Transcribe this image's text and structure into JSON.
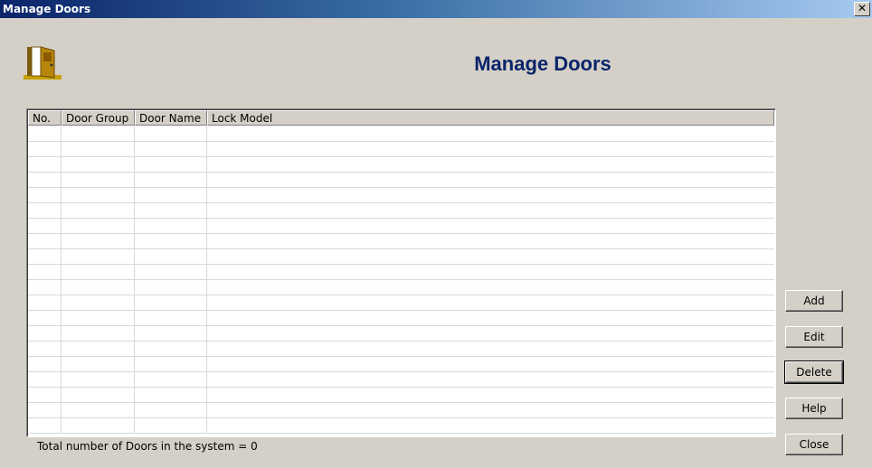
{
  "window": {
    "title": "Manage Doors",
    "close_glyph": "✕"
  },
  "header": {
    "title": "Manage Doors",
    "icon": "door-icon"
  },
  "table": {
    "columns": [
      "No.",
      "Door Group",
      "Door Name",
      "Lock Model"
    ],
    "rows": []
  },
  "buttons": {
    "add": "Add",
    "edit": "Edit",
    "delete": "Delete",
    "help": "Help",
    "close": "Close"
  },
  "status": {
    "text": "Total number of Doors in the system =  0"
  },
  "colors": {
    "heading": "#0a246a",
    "title_bar_start": "#0a246a",
    "title_bar_end": "#a6caf0",
    "background": "#d4d0c8"
  }
}
